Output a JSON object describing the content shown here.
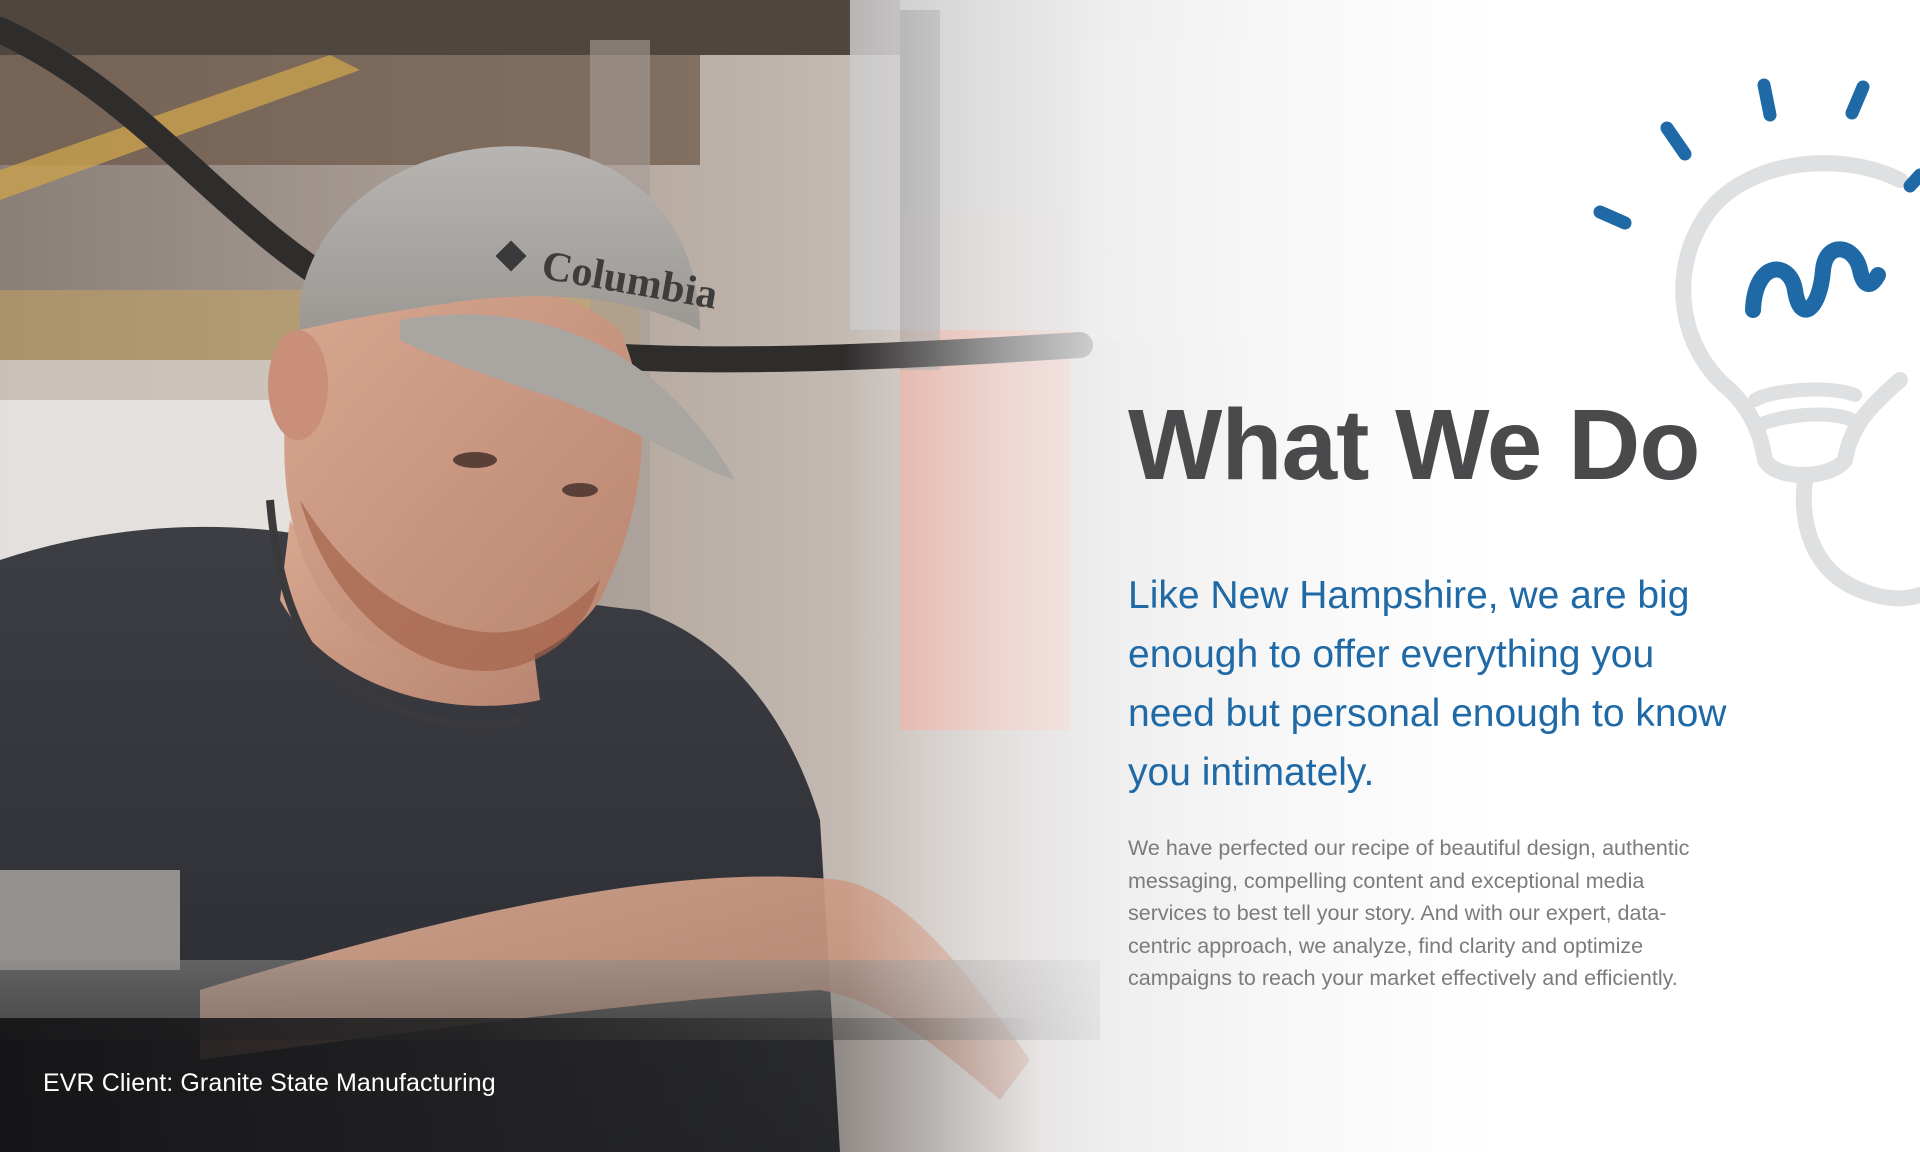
{
  "caption": "EVR Client: Granite State Manufacturing",
  "section": {
    "heading": "What We Do",
    "tagline": "Like New Hampshire, we are big enough to offer everything you need but personal enough to know you intimately.",
    "body": "We have perfected our recipe of beautiful design, authentic messaging, compelling content and exceptional media services to best tell your story. And with our expert, data-centric approach, we analyze, find clarity and optimize campaigns to reach your market effectively and efficiently."
  },
  "photo": {
    "subject": "worker-at-machine",
    "cap_brand": "Columbia"
  },
  "illustration": {
    "icon": "lightbulb-icon"
  },
  "colors": {
    "accent_blue": "#1f6aa6",
    "heading_gray": "#4a4a4c",
    "body_gray": "#7b7b7e",
    "bulb_outline": "#dfe0e1"
  }
}
